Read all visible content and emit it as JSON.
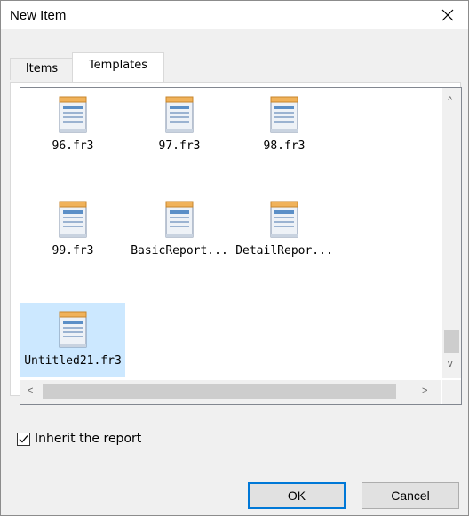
{
  "window": {
    "title": "New Item"
  },
  "tabs": [
    {
      "label": "Items",
      "active": false
    },
    {
      "label": "Templates",
      "active": true
    }
  ],
  "templates": [
    {
      "name": "96.fr3",
      "icon": "report-file-icon",
      "selected": false
    },
    {
      "name": "97.fr3",
      "icon": "report-file-icon",
      "selected": false
    },
    {
      "name": "98.fr3",
      "icon": "report-file-icon",
      "selected": false
    },
    {
      "name": "99.fr3",
      "icon": "report-file-icon",
      "selected": false
    },
    {
      "name": "BasicReport...",
      "icon": "report-file-icon",
      "selected": false
    },
    {
      "name": "DetailRepor...",
      "icon": "report-file-icon",
      "selected": false
    },
    {
      "name": "Untitled21.fr3",
      "icon": "report-file-icon",
      "selected": true
    }
  ],
  "scrollbars": {
    "vertical": {
      "up": "^",
      "down": "v"
    },
    "horizontal": {
      "left": "<",
      "right": ">"
    }
  },
  "inherit": {
    "label": "Inherit the report",
    "checked": true
  },
  "buttons": {
    "ok": "OK",
    "cancel": "Cancel"
  },
  "colors": {
    "selection": "#cce8ff",
    "accent": "#0078d7"
  }
}
